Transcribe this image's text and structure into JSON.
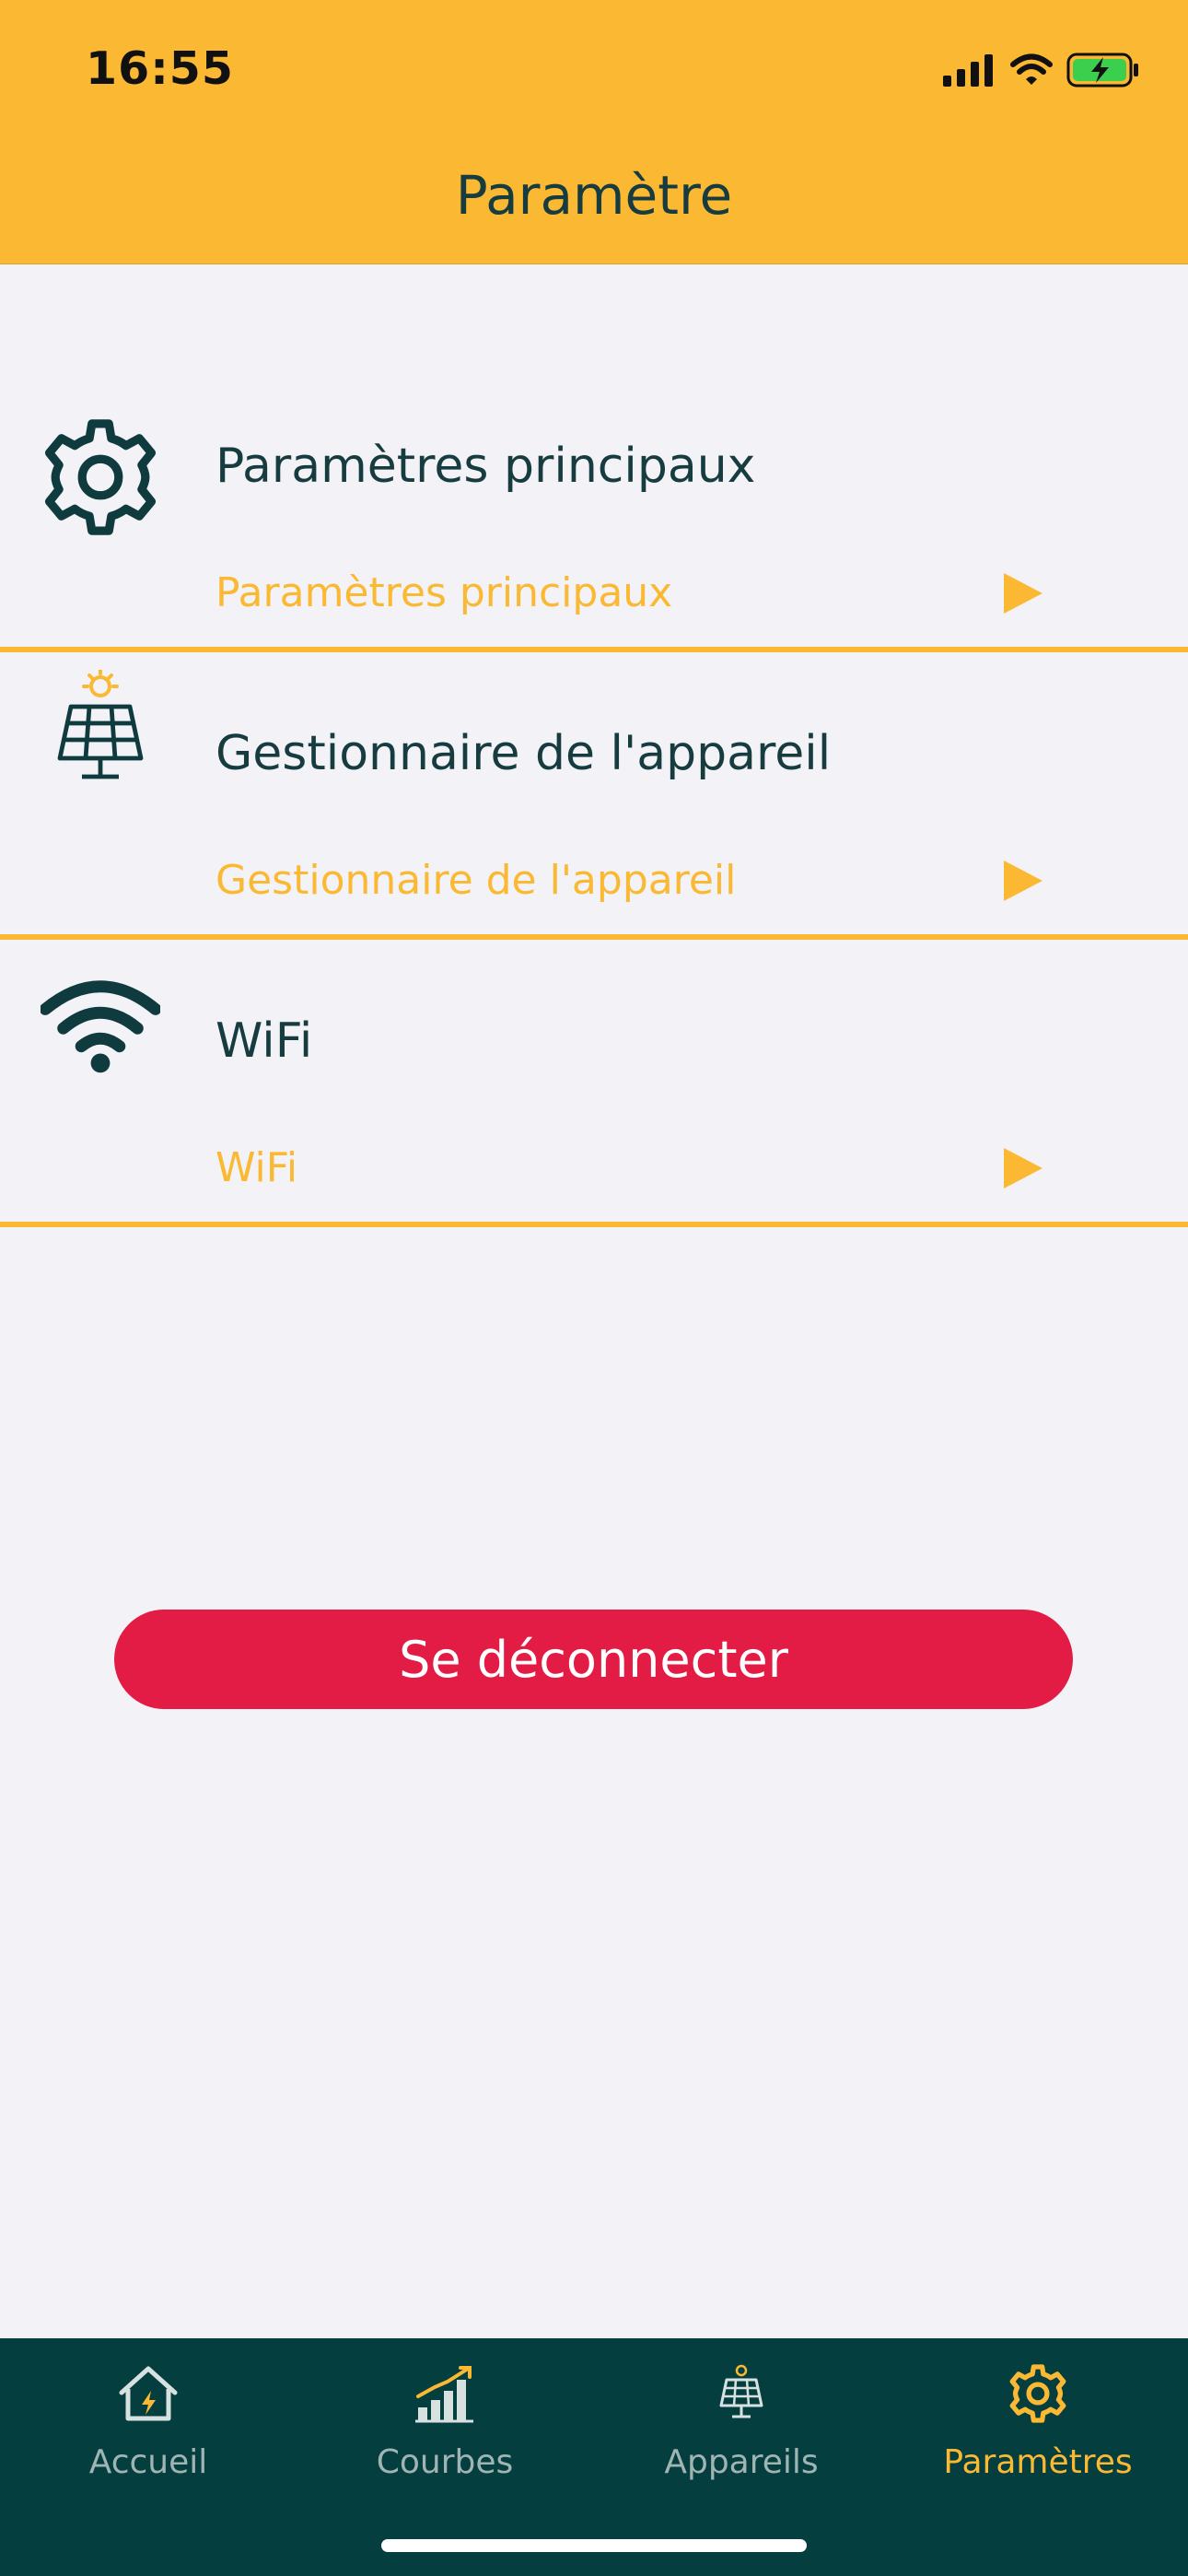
{
  "status_bar": {
    "time": "16:55",
    "icons": [
      "cellular-signal-icon",
      "wifi-signal-icon",
      "battery-charging-icon"
    ]
  },
  "header": {
    "title": "Paramètre"
  },
  "sections": [
    {
      "icon": "gear-icon",
      "title": "Paramètres principaux",
      "link": "Paramètres principaux"
    },
    {
      "icon": "solar-panel-icon",
      "title": "Gestionnaire de l'appareil",
      "link": "Gestionnaire de l'appareil"
    },
    {
      "icon": "wifi-icon",
      "title": "WiFi",
      "link": "WiFi"
    }
  ],
  "logout": {
    "label": "Se déconnecter"
  },
  "tabbar": {
    "active": "Paramètres",
    "tabs": [
      {
        "label": "Accueil",
        "icon": "home-icon"
      },
      {
        "label": "Courbes",
        "icon": "chart-icon"
      },
      {
        "label": "Appareils",
        "icon": "solar-panel-icon"
      },
      {
        "label": "Paramètres",
        "icon": "gear-icon"
      }
    ]
  },
  "colors": {
    "accent": "#fbb933",
    "primary_dark": "#053e3f",
    "text_dark": "#173c40",
    "danger": "#e21c45",
    "background": "#f2f2f7"
  }
}
